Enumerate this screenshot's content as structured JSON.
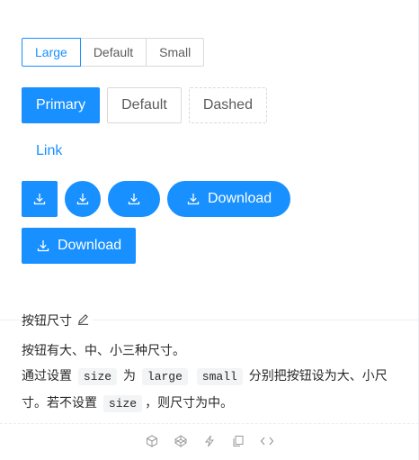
{
  "size_selector": {
    "options": [
      "Large",
      "Default",
      "Small"
    ],
    "selected": "Large"
  },
  "buttons": {
    "primary_label": "Primary",
    "default_label": "Default",
    "dashed_label": "Dashed",
    "link_label": "Link",
    "download_label": "Download",
    "download_icon": "download-icon"
  },
  "meta": {
    "title": "按钮尺寸",
    "desc_line1": "按钮有大、中、小三种尺寸。",
    "desc_p2_a": "通过设置",
    "desc_p2_code1": "size",
    "desc_p2_b": "为",
    "desc_p2_code2": "large",
    "desc_p2_code3": "small",
    "desc_p2_c": "分别把按钮设为大、小尺寸。若不设置",
    "desc_p2_code4": "size",
    "desc_p2_d": "，则尺寸为中。"
  },
  "actions": [
    "codesandbox-icon",
    "codepen-icon",
    "thunderbolt-icon",
    "copy-icon",
    "code-icon"
  ],
  "colors": {
    "primary": "#1890ff",
    "border": "#d9d9d9",
    "divider": "#ebedf0"
  }
}
